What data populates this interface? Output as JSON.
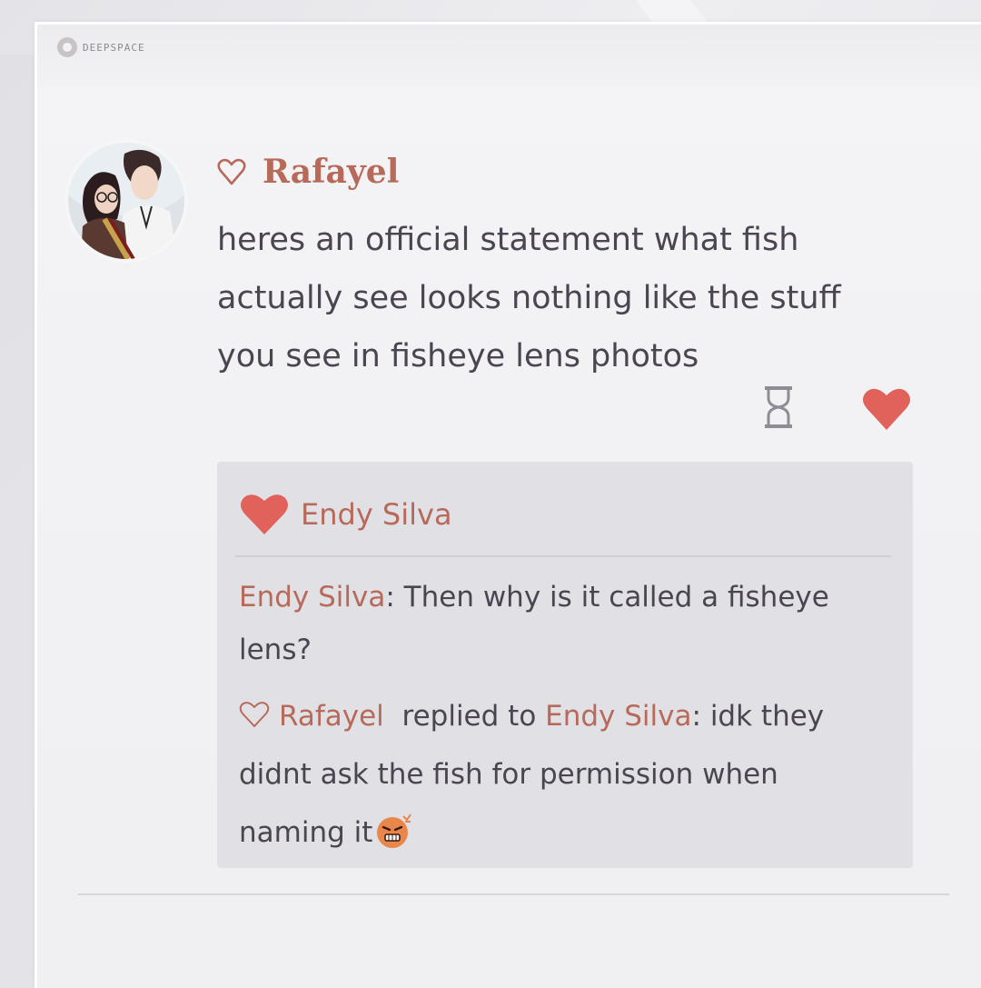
{
  "brand": {
    "name": "DEEPSPACE"
  },
  "post": {
    "author": "Rafayel",
    "text": "heres an official statement what fish actually see looks nothing like the stuff you see in fisheye lens photos"
  },
  "likes": {
    "names": "Endy Silva"
  },
  "comments": [
    {
      "author": "Endy Silva",
      "separator": ": ",
      "text": "Then why is it called a fisheye lens?"
    },
    {
      "author": "Rafayel",
      "reply_label": "replied to",
      "target": "Endy Silva",
      "separator": ": ",
      "text": "idk they didnt ask the fish for permission when naming it"
    }
  ],
  "colors": {
    "accent": "#b86a5a",
    "like_heart": "#e0625a",
    "text": "#4a4550",
    "panel": "#e1e1e5"
  },
  "icons": {
    "poster_heart": "heart-outline-icon",
    "time": "hourglass-icon",
    "like": "heart-filled-icon",
    "emoji": "angry-face-emoji"
  }
}
